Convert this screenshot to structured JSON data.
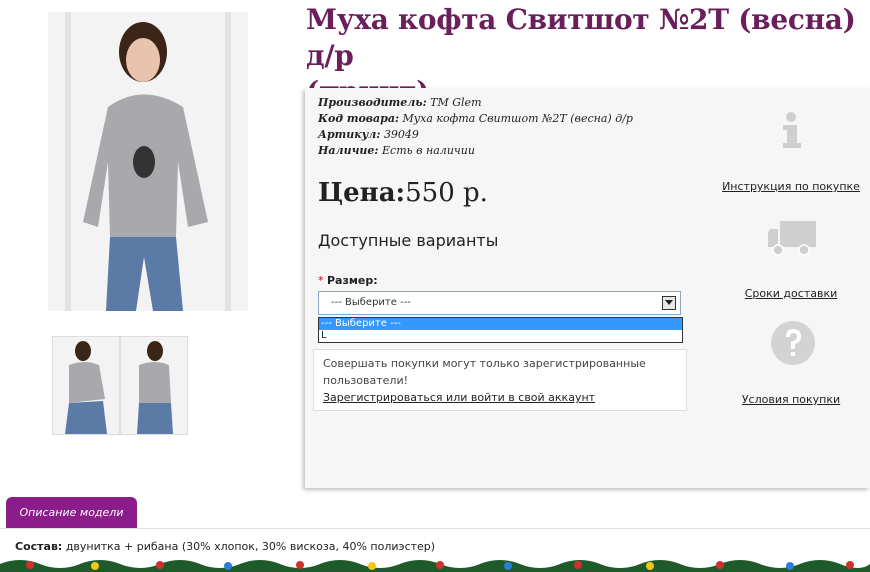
{
  "product": {
    "title_line1": "Муха кофта Свитшот №2Т (весна) д/р",
    "title_line2": "(принт)",
    "manufacturer_label": "Производитель:",
    "manufacturer": "ТМ Glem",
    "code_label": "Код товара:",
    "code": "Муха кофта Свитшот №2Т (весна) д/р",
    "sku_label": "Артикул:",
    "sku": "39049",
    "stock_label": "Наличие:",
    "stock": "Есть в наличии",
    "price_label": "Цена:",
    "price": "550 р."
  },
  "options": {
    "heading": "Доступные варианты",
    "required_mark": "*",
    "size_label": "Размер:",
    "select_value": "--- Выберите ---",
    "dropdown_items": [
      "--- Выберите ---",
      "L"
    ],
    "selected_index": 0
  },
  "notice": {
    "text": "Совершать покупки могут только зарегистрированные пользователи!",
    "link": "Зарегистрироваться или войти в свой аккаунт"
  },
  "sidebar": {
    "links": [
      {
        "icon": "info-icon",
        "label": "Инструкция по покупке"
      },
      {
        "icon": "truck-icon",
        "label": "Сроки доставки"
      },
      {
        "icon": "question-icon",
        "label": "Условия покупки"
      }
    ]
  },
  "tabs": {
    "description_tab": "Описание модели"
  },
  "description": {
    "composition_label": "Состав:",
    "composition": "двунитка + рибана (30% хлопок, 30% вискоза, 40% полиэстер)"
  },
  "colors": {
    "title": "#6b1e5c",
    "tab": "#8a1d8a",
    "panel": "#f6f6f6"
  }
}
